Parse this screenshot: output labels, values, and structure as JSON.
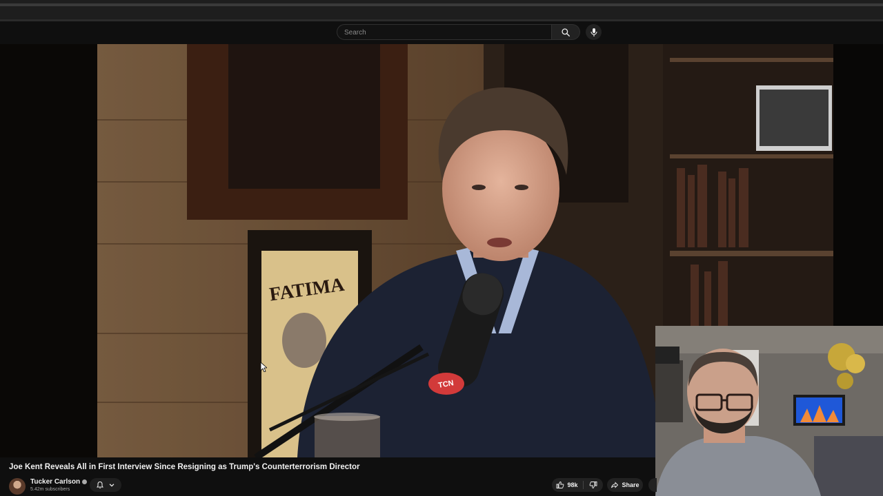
{
  "search": {
    "placeholder": "Search"
  },
  "video": {
    "title": "Joe Kent Reveals All in First Interview Since Resigning as Trump's Counterterrorism Director",
    "poster_text": "FATIMA",
    "mic_brand": "TCN"
  },
  "channel": {
    "name": "Tucker Carlson",
    "subscribers": "5.42m subscribers"
  },
  "actions": {
    "likes": "98k",
    "share_label": "Share"
  },
  "icons": {
    "search": "search-icon",
    "mic": "microphone-icon",
    "bell": "bell-icon",
    "chevron": "chevron-down-icon",
    "like": "thumbs-up-icon",
    "dislike": "thumbs-down-icon",
    "share": "share-icon"
  },
  "colors": {
    "background": "#0f0f0f",
    "text": "#f1f1f1",
    "secondary_text": "#aaaaaa",
    "button": "#222222"
  }
}
